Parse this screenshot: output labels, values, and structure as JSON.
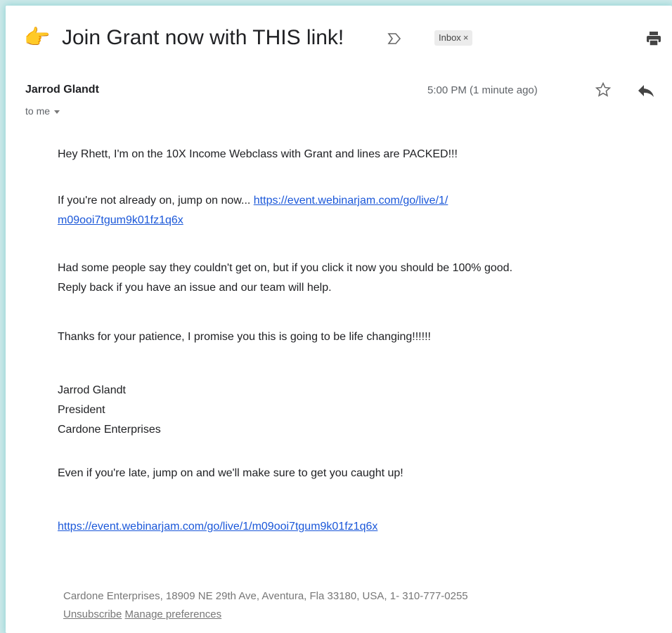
{
  "email": {
    "subject_emoji": "👉",
    "subject": "Join Grant now with THIS link!",
    "label_chip": "Inbox",
    "label_chip_close": "×",
    "sender": "Jarrod Glandt",
    "time": "5:00 PM (1 minute ago)",
    "recipient": "to me",
    "body": {
      "greeting": "Hey Rhett, I'm on the 10X Income Webclass with Grant and lines are PACKED!!!",
      "para2_text": "If you're not already on, jump on now... ",
      "para2_link_line1": "https://event.webinarjam.com/go/live/1/",
      "para2_link_line2": "m09ooi7tgum9k01fz1q6x",
      "para3_line1": "Had some people say they couldn't get on, but if you click it now you should be 100% good.",
      "para3_line2": "Reply back if you have an issue and our team will help.",
      "para4": "Thanks for your patience, I promise you this is going to be life changing!!!!!!",
      "signature_name": "Jarrod Glandt",
      "signature_title": "President",
      "signature_company": "Cardone Enterprises",
      "para6": "Even if you're late, jump on and we'll make sure to get you caught up!",
      "para7_link": "https://event.webinarjam.com/go/live/1/m09ooi7tgum9k01fz1q6x"
    },
    "footer": {
      "address": "Cardone Enterprises, 18909 NE 29th Ave, Aventura, Fla 33180, USA, 1- 310-777-0255",
      "unsubscribe": "Unsubscribe",
      "manage": "Manage preferences"
    }
  },
  "colors": {
    "link": "#1a57d9",
    "text": "#202124",
    "muted": "#5f6368",
    "background": "#cfe9ea"
  }
}
